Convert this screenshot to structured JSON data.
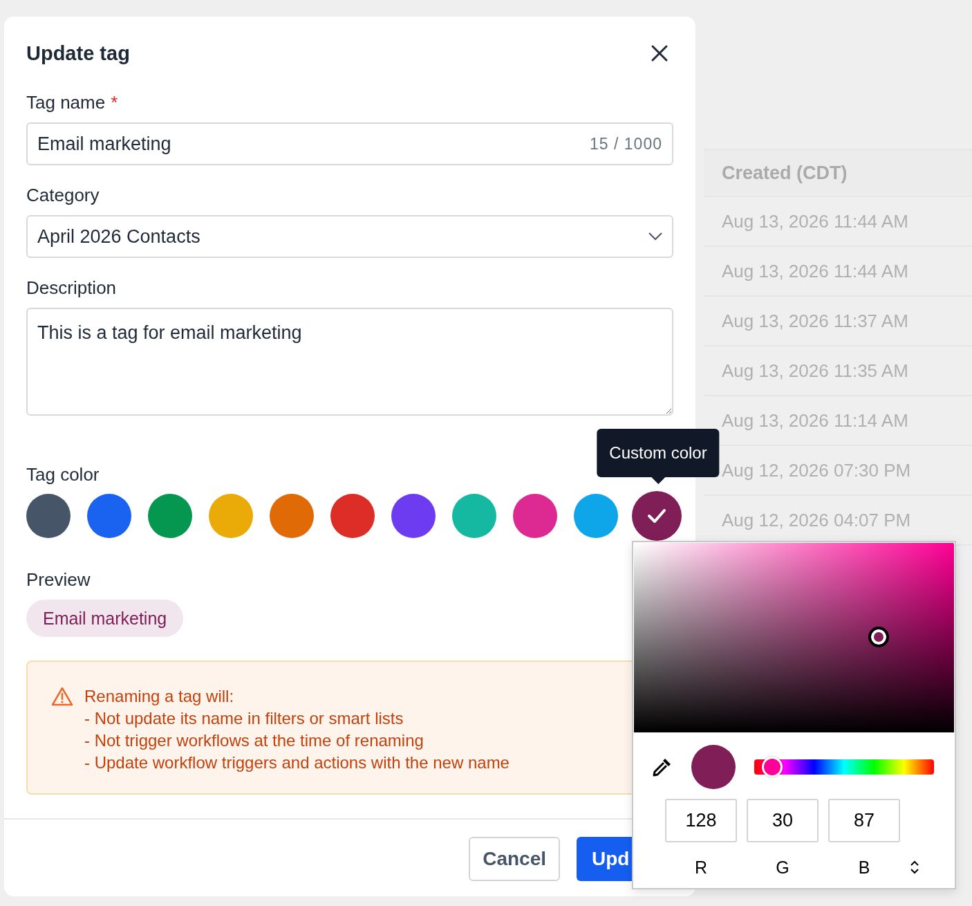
{
  "background_table": {
    "header": "Created (CDT)",
    "rows": [
      "Aug 13, 2026 11:44 AM",
      "Aug 13, 2026 11:44 AM",
      "Aug 13, 2026 11:37 AM",
      "Aug 13, 2026 11:35 AM",
      "Aug 13, 2026 11:14 AM",
      "Aug 12, 2026 07:30 PM",
      "Aug 12, 2026 04:07 PM"
    ]
  },
  "dialog": {
    "title": "Update tag",
    "tag_name": {
      "label": "Tag name",
      "required_mark": "*",
      "value": "Email marketing",
      "counter": "15 / 1000"
    },
    "category": {
      "label": "Category",
      "value": "April 2026 Contacts"
    },
    "description": {
      "label": "Description",
      "value": "This is a tag for email marketing"
    },
    "tag_color": {
      "label": "Tag color",
      "tooltip": "Custom color",
      "swatches": [
        {
          "color": "#475569",
          "selected": false
        },
        {
          "color": "#1a62f0",
          "selected": false
        },
        {
          "color": "#059650",
          "selected": false
        },
        {
          "color": "#eaab08",
          "selected": false
        },
        {
          "color": "#e06a06",
          "selected": false
        },
        {
          "color": "#dc2e26",
          "selected": false
        },
        {
          "color": "#6e3cf0",
          "selected": false
        },
        {
          "color": "#15b8a0",
          "selected": false
        },
        {
          "color": "#dd2a93",
          "selected": false
        },
        {
          "color": "#0ea5e9",
          "selected": false
        },
        {
          "color": "#801e57",
          "selected": true
        }
      ]
    },
    "preview": {
      "label": "Preview",
      "tag": "Email marketing"
    },
    "warning": {
      "title": "Renaming a tag will:",
      "lines": [
        "- Not update its name in filters or smart lists",
        "- Not trigger workflows at the time of renaming",
        "- Update workflow triggers and actions with the new name"
      ]
    },
    "buttons": [
      {
        "label": "Cancel",
        "kind": "secondary"
      },
      {
        "label": "Upd",
        "kind": "primary"
      }
    ]
  },
  "color_picker": {
    "hue": {
      "level": 0.1
    },
    "channels": [
      {
        "label": "R",
        "value": "128"
      },
      {
        "label": "G",
        "value": "30"
      },
      {
        "label": "B",
        "value": "87"
      }
    ]
  }
}
